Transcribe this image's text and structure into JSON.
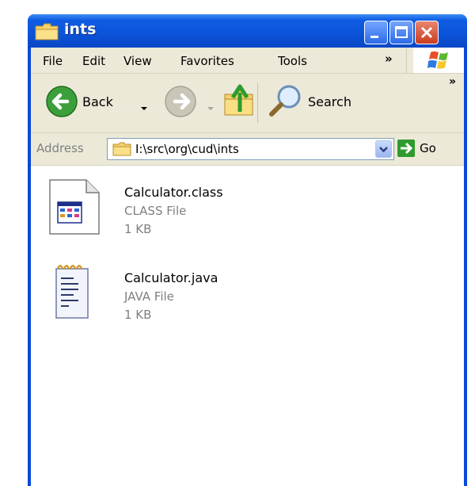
{
  "window": {
    "title": "ints",
    "accent": "#0a49d8",
    "caption_buttons": [
      "minimize",
      "maximize",
      "close"
    ]
  },
  "menu": {
    "items": [
      "File",
      "Edit",
      "View",
      "Favorites",
      "Tools"
    ],
    "overflow": "»"
  },
  "toolbar": {
    "back_label": "Back",
    "search_label": "Search",
    "overflow": "»"
  },
  "address": {
    "label": "Address",
    "value": "I:\\src\\org\\cud\\ints",
    "go_label": "Go"
  },
  "files": [
    {
      "name": "Calculator.class",
      "type": "CLASS File",
      "size": "1 KB",
      "icon": "class-file-icon"
    },
    {
      "name": "Calculator.java",
      "type": "JAVA File",
      "size": "1 KB",
      "icon": "java-file-icon"
    }
  ]
}
